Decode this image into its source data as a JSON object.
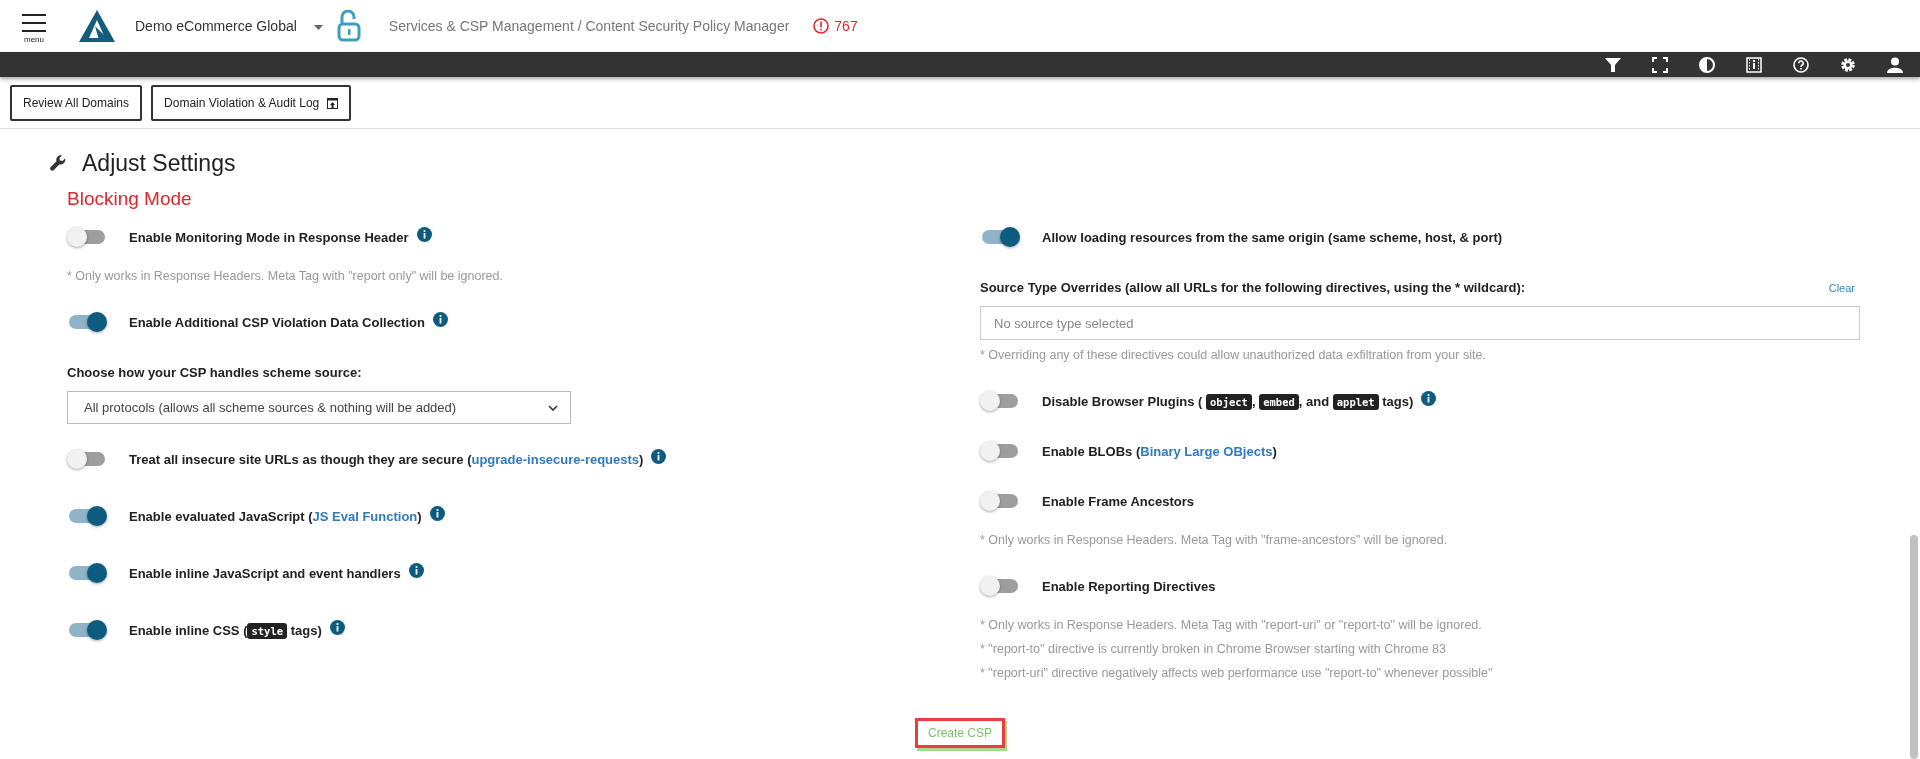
{
  "header": {
    "menu_label": "menu",
    "site_name": "Demo eCommerce Global",
    "breadcrumb": "Services & CSP Management / Content Security Policy Manager",
    "alert_count": "767"
  },
  "actions": [
    {
      "label": "Review All Domains",
      "kind": "plain"
    },
    {
      "label": "Domain Violation & Audit Log",
      "kind": "export"
    }
  ],
  "section": {
    "title": "Adjust Settings",
    "subtitle": "Blocking Mode"
  },
  "left_settings": [
    {
      "kind": "toggle",
      "on": false,
      "info": true,
      "label": [
        {
          "kind": "text",
          "text": "Enable Monitoring Mode in Response Header"
        }
      ]
    },
    {
      "kind": "note",
      "text": "* Only works in Response Headers. Meta Tag with \"report only\" will be ignored."
    },
    {
      "kind": "toggle",
      "on": true,
      "info": true,
      "label": [
        {
          "kind": "text",
          "text": "Enable Additional CSP Violation Data Collection"
        }
      ]
    },
    {
      "kind": "select",
      "label": "Choose how your CSP handles scheme source:",
      "value": "All protocols (allows all scheme sources & nothing will be added)"
    },
    {
      "kind": "toggle",
      "on": false,
      "info": true,
      "label": [
        {
          "kind": "text",
          "text": "Treat all insecure site URLs as though they are secure ("
        },
        {
          "kind": "link",
          "text": "upgrade-insecure-requests"
        },
        {
          "kind": "text",
          "text": ")"
        }
      ]
    },
    {
      "kind": "toggle",
      "on": true,
      "info": true,
      "label": [
        {
          "kind": "text",
          "text": "Enable evaluated JavaScript ("
        },
        {
          "kind": "link",
          "text": "JS Eval Function"
        },
        {
          "kind": "text",
          "text": ")"
        }
      ]
    },
    {
      "kind": "toggle",
      "on": true,
      "info": true,
      "label": [
        {
          "kind": "text",
          "text": "Enable inline JavaScript and event handlers"
        }
      ]
    },
    {
      "kind": "toggle",
      "on": true,
      "info": true,
      "label": [
        {
          "kind": "text",
          "text": "Enable inline CSS ("
        },
        {
          "kind": "code",
          "text": "style"
        },
        {
          "kind": "text",
          "text": " tags)"
        }
      ]
    }
  ],
  "right_settings": [
    {
      "kind": "toggle",
      "on": true,
      "info": false,
      "label": [
        {
          "kind": "text",
          "text": "Allow loading resources from the same origin (same scheme, host, & port)"
        }
      ]
    },
    {
      "kind": "multiselect",
      "label": "Source Type Overrides (allow all URLs for the following directives, using the * wildcard):",
      "action": "Clear",
      "placeholder": "No source type selected"
    },
    {
      "kind": "note",
      "text": "* Overriding any of these directives could allow unauthorized data exfiltration from your site."
    },
    {
      "kind": "toggle",
      "on": false,
      "info": true,
      "label": [
        {
          "kind": "text",
          "text": "Disable Browser Plugins ( "
        },
        {
          "kind": "code",
          "text": "object"
        },
        {
          "kind": "text",
          "text": ", "
        },
        {
          "kind": "code",
          "text": "embed"
        },
        {
          "kind": "text",
          "text": ", and "
        },
        {
          "kind": "code",
          "text": "applet"
        },
        {
          "kind": "text",
          "text": " tags)"
        }
      ]
    },
    {
      "kind": "toggle",
      "on": false,
      "info": false,
      "label": [
        {
          "kind": "text",
          "text": "Enable BLOBs ("
        },
        {
          "kind": "link",
          "text": "Binary Large OBjects"
        },
        {
          "kind": "text",
          "text": ")"
        }
      ]
    },
    {
      "kind": "toggle",
      "on": false,
      "info": false,
      "label": [
        {
          "kind": "text",
          "text": "Enable Frame Ancestors"
        }
      ]
    },
    {
      "kind": "note",
      "text": "* Only works in Response Headers. Meta Tag with \"frame-ancestors\" will be ignored."
    },
    {
      "kind": "toggle",
      "on": false,
      "info": false,
      "label": [
        {
          "kind": "text",
          "text": "Enable Reporting Directives"
        }
      ]
    },
    {
      "kind": "note",
      "text": "* Only works in Response Headers. Meta Tag with \"report-uri\" or \"report-to\" will be ignored."
    },
    {
      "kind": "note",
      "text": "* \"report-to\" directive is currently broken in Chrome Browser starting with Chrome 83"
    },
    {
      "kind": "note",
      "text": "* \"report-uri\" directive negatively affects web performance use \"report-to\" whenever possible\""
    }
  ],
  "submit": "Create CSP"
}
